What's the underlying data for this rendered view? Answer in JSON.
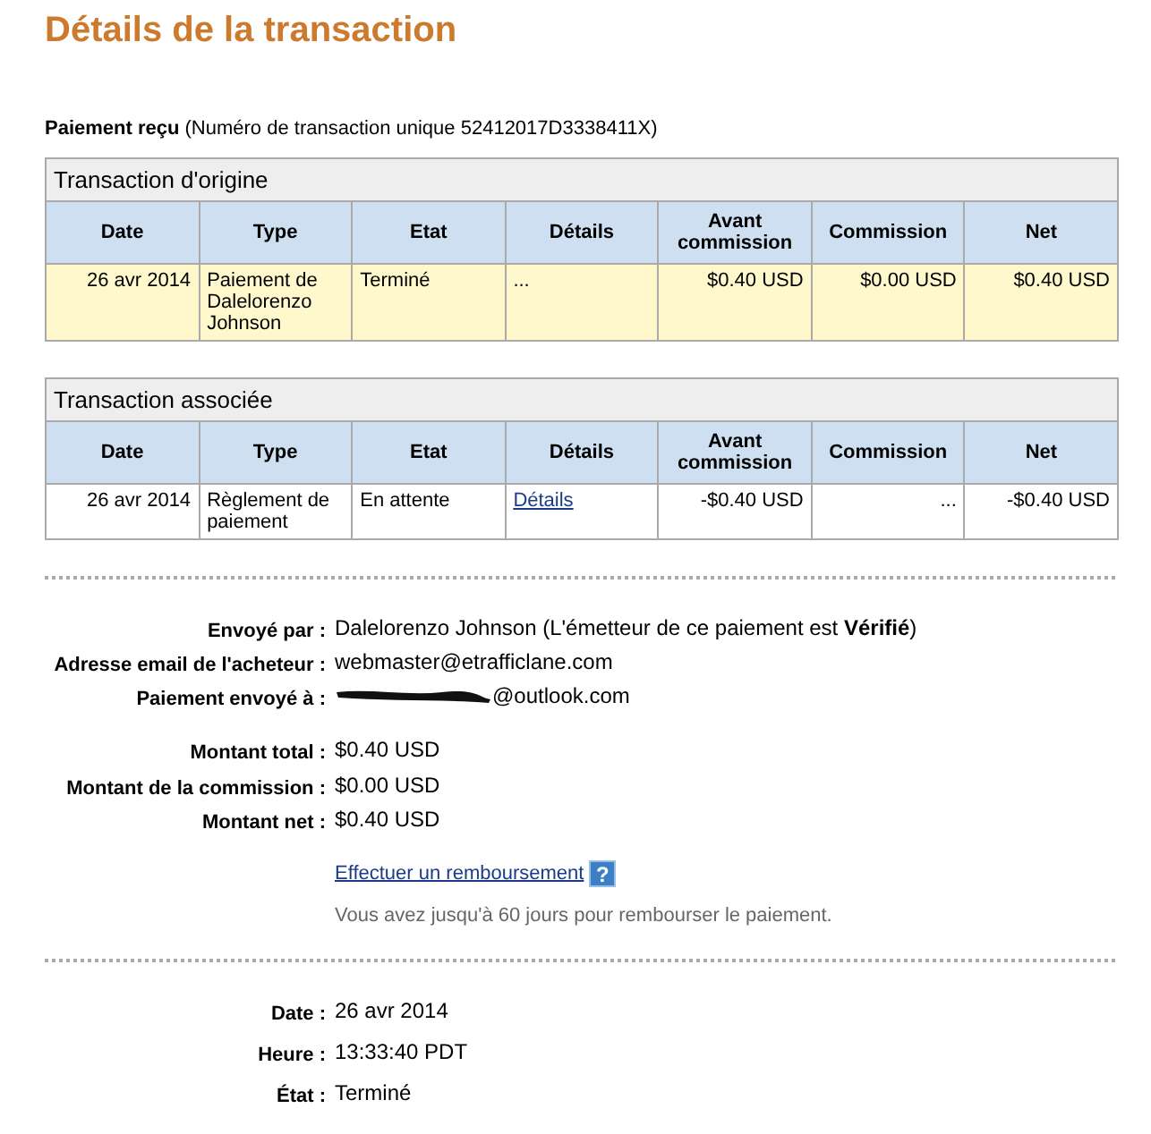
{
  "title": "Détails de la transaction",
  "summary": {
    "label": "Paiement reçu",
    "text": "(Numéro de transaction unique 52412017D3338411X)"
  },
  "tables": [
    {
      "caption": "Transaction d'origine",
      "columns": [
        "Date",
        "Type",
        "Etat",
        "Détails",
        "Avant commission",
        "Commission",
        "Net"
      ],
      "rows": [
        {
          "highlighted": true,
          "cells": [
            {
              "kind": "text",
              "text": "26 avr 2014"
            },
            {
              "kind": "text",
              "text": "Paiement de Dalelorenzo Johnson"
            },
            {
              "kind": "text",
              "text": "Terminé"
            },
            {
              "kind": "text",
              "text": "..."
            },
            {
              "kind": "text",
              "text": "$0.40 USD"
            },
            {
              "kind": "text",
              "text": "$0.00 USD"
            },
            {
              "kind": "text",
              "text": "$0.40 USD"
            }
          ]
        }
      ]
    },
    {
      "caption": "Transaction associée",
      "columns": [
        "Date",
        "Type",
        "Etat",
        "Détails",
        "Avant commission",
        "Commission",
        "Net"
      ],
      "rows": [
        {
          "highlighted": false,
          "cells": [
            {
              "kind": "text",
              "text": "26 avr 2014"
            },
            {
              "kind": "text",
              "text": "Règlement de paiement"
            },
            {
              "kind": "text",
              "text": "En attente"
            },
            {
              "kind": "link",
              "text": "Détails"
            },
            {
              "kind": "text",
              "text": "-$0.40 USD"
            },
            {
              "kind": "text",
              "text": "..."
            },
            {
              "kind": "text",
              "text": "-$0.40 USD"
            }
          ]
        }
      ]
    }
  ],
  "details": [
    [
      {
        "label": "Envoyé par :",
        "value": "Dalelorenzo Johnson (L'émetteur de ce paiement est **Vérifié**)",
        "kind": "text"
      },
      {
        "label": "Adresse email de l'acheteur :",
        "value": "webmaster@etrafficlane.com",
        "kind": "text"
      },
      {
        "label": "Paiement envoyé à :",
        "value": "@outlook.com",
        "kind": "redacted"
      }
    ],
    [
      {
        "label": "Montant total :",
        "value": "$0.40 USD",
        "kind": "text"
      }
    ],
    [
      {
        "label": "Montant de la commission :",
        "value": "$0.00 USD",
        "kind": "text"
      },
      {
        "label": "Montant net :",
        "value": "$0.40 USD",
        "kind": "text"
      }
    ]
  ],
  "refund": {
    "link": "Effectuer un remboursement",
    "help": "?",
    "note": "Vous avez jusqu'à 60 jours pour rembourser le paiement."
  },
  "status": [
    {
      "label": "Date :",
      "value": "26 avr 2014"
    },
    {
      "label": "Heure :",
      "value": "13:33:40 PDT"
    },
    {
      "label": "État :",
      "value": "Terminé"
    }
  ]
}
